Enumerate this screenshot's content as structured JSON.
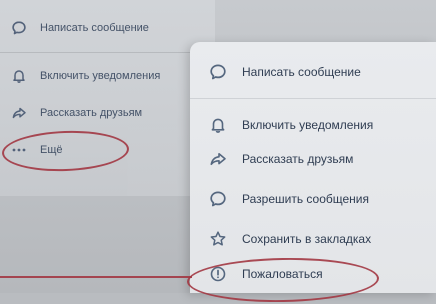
{
  "left_menu": {
    "items": [
      {
        "label": "Написать сообщение",
        "icon": "message-icon"
      },
      {
        "label": "Включить уведомления",
        "icon": "bell-icon"
      },
      {
        "label": "Рассказать друзьям",
        "icon": "share-icon"
      },
      {
        "label": "Ещё",
        "icon": "more-icon"
      }
    ]
  },
  "popup_menu": {
    "items": [
      {
        "label": "Написать сообщение",
        "icon": "message-icon"
      },
      {
        "label": "Включить уведомления",
        "icon": "bell-icon"
      },
      {
        "label": "Рассказать друзьям",
        "icon": "share-icon"
      },
      {
        "label": "Разрешить сообщения",
        "icon": "message-icon"
      },
      {
        "label": "Сохранить в закладках",
        "icon": "star-icon"
      },
      {
        "label": "Пожаловаться",
        "icon": "report-icon"
      }
    ]
  },
  "colors": {
    "annotation": "#a23742",
    "menu_text": "#2f3d52",
    "icon": "#55677f"
  }
}
